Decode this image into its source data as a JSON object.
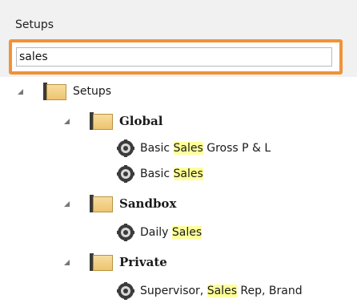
{
  "panel": {
    "label": "Setups"
  },
  "search": {
    "value": "sales"
  },
  "tree": {
    "root": "Setups",
    "global": {
      "label": "Global",
      "items": [
        {
          "pre": "Basic ",
          "match": "Sales",
          "post": " Gross P & L"
        },
        {
          "pre": "Basic ",
          "match": "Sales",
          "post": ""
        }
      ]
    },
    "sandbox": {
      "label": "Sandbox",
      "items": [
        {
          "pre": "Daily ",
          "match": "Sales",
          "post": ""
        }
      ]
    },
    "private": {
      "label": "Private",
      "items": [
        {
          "pre": "Supervisor, ",
          "match": "Sales",
          "post": " Rep, Brand"
        }
      ]
    }
  },
  "colors": {
    "highlight": "#ffff99",
    "focus_border": "#f0923a",
    "folder": "#eec46f"
  }
}
